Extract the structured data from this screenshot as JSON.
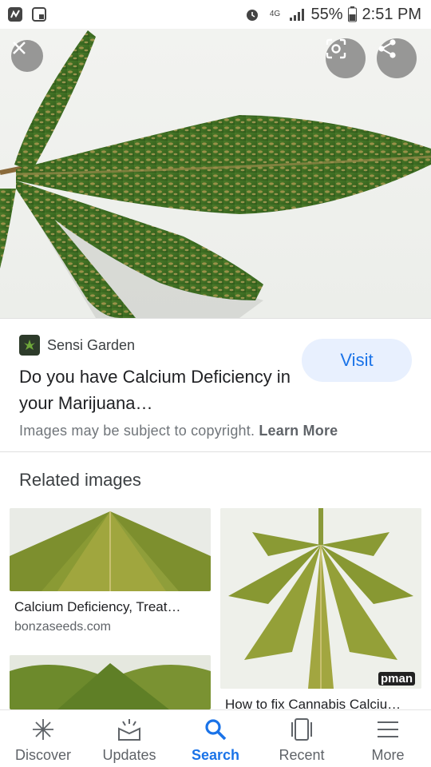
{
  "status_bar": {
    "battery": "55%",
    "time": "2:51 PM",
    "network": "4G",
    "icons": [
      "app-notification-icon",
      "screenshot-icon",
      "alarm-icon",
      "data-icon",
      "signal-icon",
      "battery-icon"
    ]
  },
  "hero": {
    "image": "cannabis-leaf-spotted-image",
    "buttons": [
      "close-icon",
      "lens-icon",
      "share-icon"
    ]
  },
  "result": {
    "source": "Sensi Garden",
    "title": "Do you have Calcium Deficiency in your Marijuana…",
    "visit_label": "Visit",
    "copyright": "Images may be subject to copyright.",
    "learn_more": "Learn More"
  },
  "related": {
    "heading": "Related images",
    "items": [
      {
        "caption": "Calcium Deficiency, Treat…",
        "domain": "bonzaseeds.com"
      },
      {
        "caption": "How to fix Cannabis Calciu…",
        "watermark": "pman"
      }
    ]
  },
  "nav": {
    "items": [
      {
        "label": "Discover",
        "icon": "discover-icon"
      },
      {
        "label": "Updates",
        "icon": "updates-icon"
      },
      {
        "label": "Search",
        "icon": "search-icon"
      },
      {
        "label": "Recent",
        "icon": "recent-icon"
      },
      {
        "label": "More",
        "icon": "menu-icon"
      }
    ],
    "active": "Search"
  },
  "colors": {
    "accent": "#1a73e8",
    "visit_bg": "#e8f0fe"
  }
}
